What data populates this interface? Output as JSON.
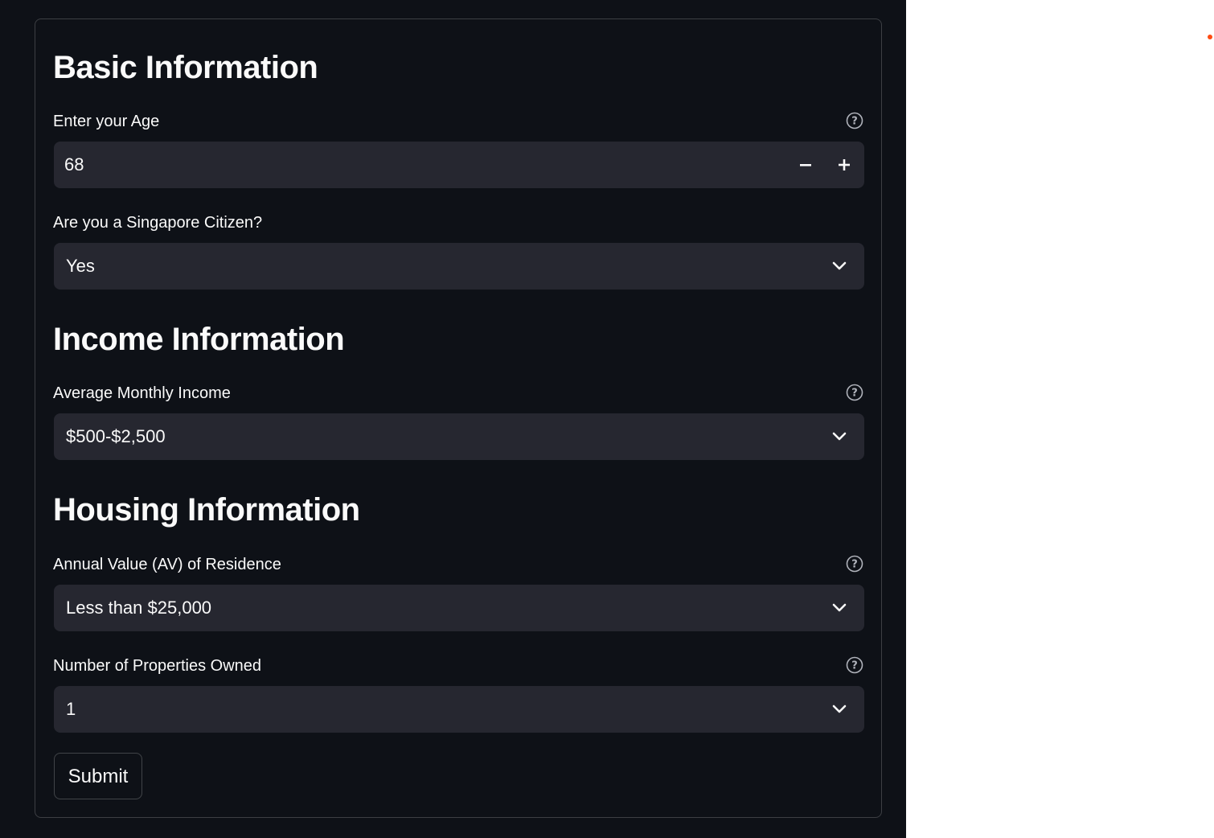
{
  "theme": {
    "background": "#0e1117",
    "input_background": "#262730",
    "text": "#fafafa",
    "side_panel": "#ffffff",
    "status_dot": "#ff4b12"
  },
  "basic": {
    "title": "Basic Information",
    "age": {
      "label": "Enter your Age",
      "value": "68",
      "decrement_icon": "minus-icon",
      "increment_icon": "plus-icon",
      "help_icon": "question-circle-icon"
    },
    "citizen": {
      "label": "Are you a Singapore Citizen?",
      "selected": "Yes",
      "dropdown_icon": "chevron-down-icon"
    }
  },
  "income": {
    "title": "Income Information",
    "monthly_income": {
      "label": "Average Monthly Income",
      "selected": "$500-$2,500",
      "help_icon": "question-circle-icon",
      "dropdown_icon": "chevron-down-icon"
    }
  },
  "housing": {
    "title": "Housing Information",
    "annual_value": {
      "label": "Annual Value (AV) of Residence",
      "selected": "Less than $25,000",
      "help_icon": "question-circle-icon",
      "dropdown_icon": "chevron-down-icon"
    },
    "properties": {
      "label": "Number of Properties Owned",
      "selected": "1",
      "help_icon": "question-circle-icon",
      "dropdown_icon": "chevron-down-icon"
    }
  },
  "submit_label": "Submit"
}
